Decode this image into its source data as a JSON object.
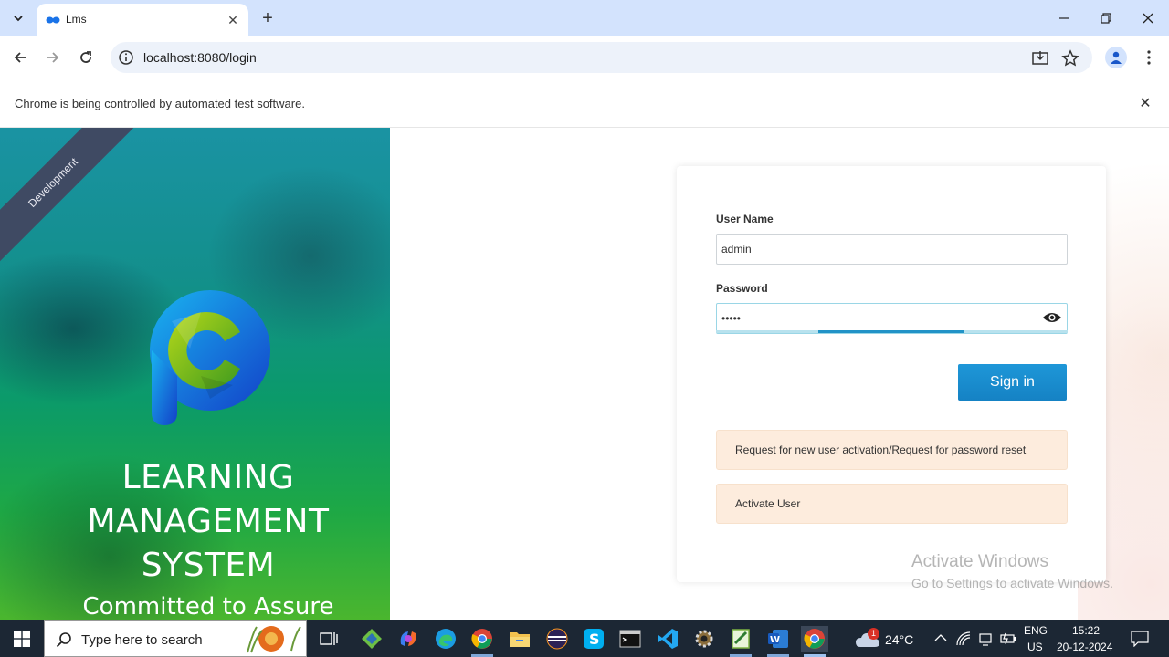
{
  "browser": {
    "tab_title": "Lms",
    "url": "localhost:8080/login",
    "infobar_text": "Chrome is being controlled by automated test software."
  },
  "left_panel": {
    "ribbon": "Development",
    "title_lines": [
      "LEARNING",
      "MANAGEMENT",
      "SYSTEM"
    ],
    "subtitle": "Committed to Assure"
  },
  "login": {
    "username_label": "User Name",
    "username_value": "admin",
    "password_label": "Password",
    "password_value": "•••••",
    "signin_label": "Sign in",
    "request_link": "Request for new user activation/Request for password reset",
    "activate_link": "Activate User"
  },
  "watermark": {
    "line1": "Activate Windows",
    "line2": "Go to Settings to activate Windows."
  },
  "taskbar": {
    "search_placeholder": "Type here to search",
    "weather_temp": "24°C",
    "weather_badge": "1",
    "lang_line1": "ENG",
    "lang_line2": "US",
    "time": "15:22",
    "date": "20-12-2024"
  },
  "colors": {
    "accent": "#1d8fd0",
    "tabstrip": "#d3e3fd",
    "alert_bg": "#fdecdd",
    "taskbar": "#1c2734"
  }
}
